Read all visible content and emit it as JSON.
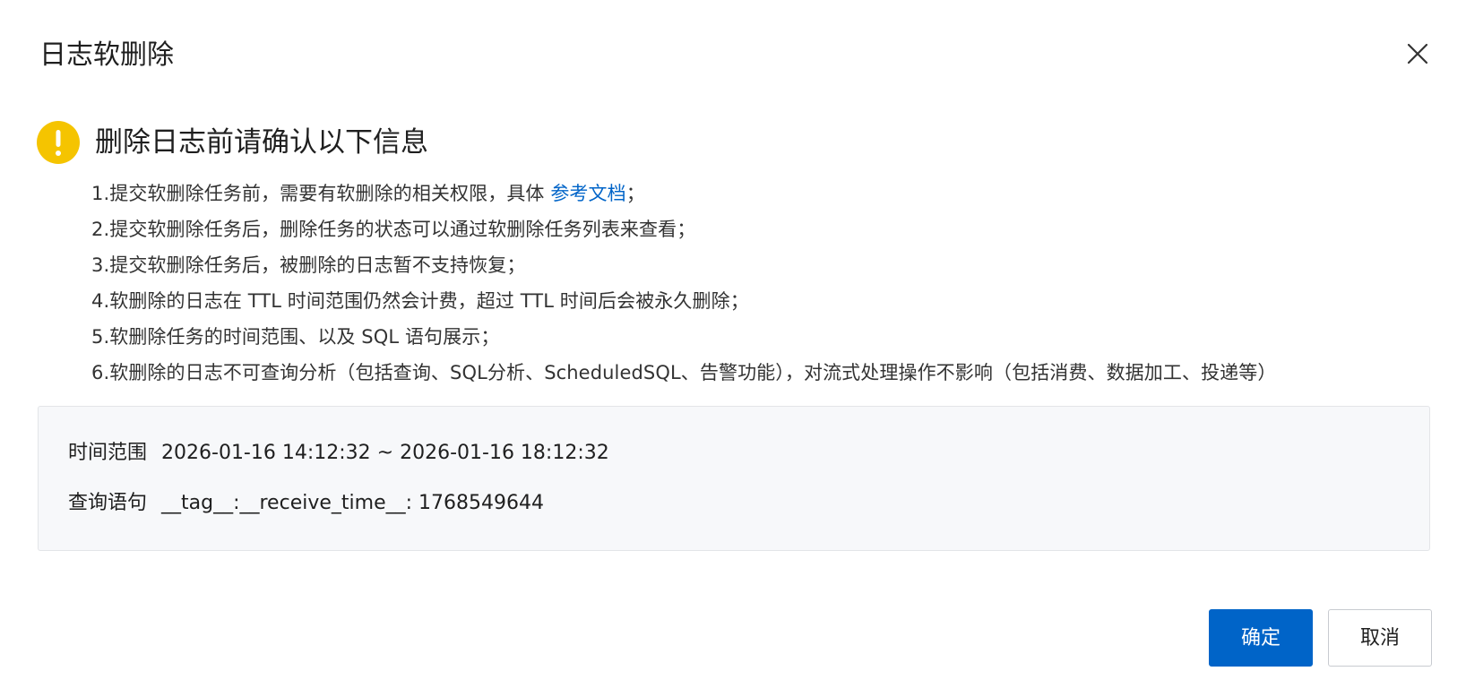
{
  "dialog": {
    "title": "日志软删除",
    "close_icon": "close-icon"
  },
  "warning": {
    "icon": "exclamation-circle-icon",
    "icon_color": "#f5c400",
    "title": "删除日志前请确认以下信息"
  },
  "notes": {
    "item1_prefix": "1.提交软删除任务前，需要有软删除的相关权限，具体 ",
    "item1_link": "参考文档",
    "item1_suffix": "；",
    "item2": "2.提交软删除任务后，删除任务的状态可以通过软删除任务列表来查看；",
    "item3": "3.提交软删除任务后，被删除的日志暂不支持恢复；",
    "item4": "4.软删除的日志在 TTL 时间范围仍然会计费，超过 TTL 时间后会被永久删除；",
    "item5": "5.软删除任务的时间范围、以及 SQL 语句展示；",
    "item6": "6.软删除的日志不可查询分析（包括查询、SQL分析、ScheduledSQL、告警功能），对流式处理操作不影响（包括消费、数据加工、投递等）"
  },
  "info": {
    "time_range_label": "时间范围",
    "time_range_value": "2026-01-16 14:12:32 ~ 2026-01-16 18:12:32",
    "query_label": "查询语句",
    "query_value": "__tag__:__receive_time__: 1768549644"
  },
  "footer": {
    "confirm_label": "确定",
    "cancel_label": "取消"
  },
  "colors": {
    "primary": "#0064c8",
    "warning": "#f5c400",
    "panel_bg": "#f7f8fa"
  }
}
